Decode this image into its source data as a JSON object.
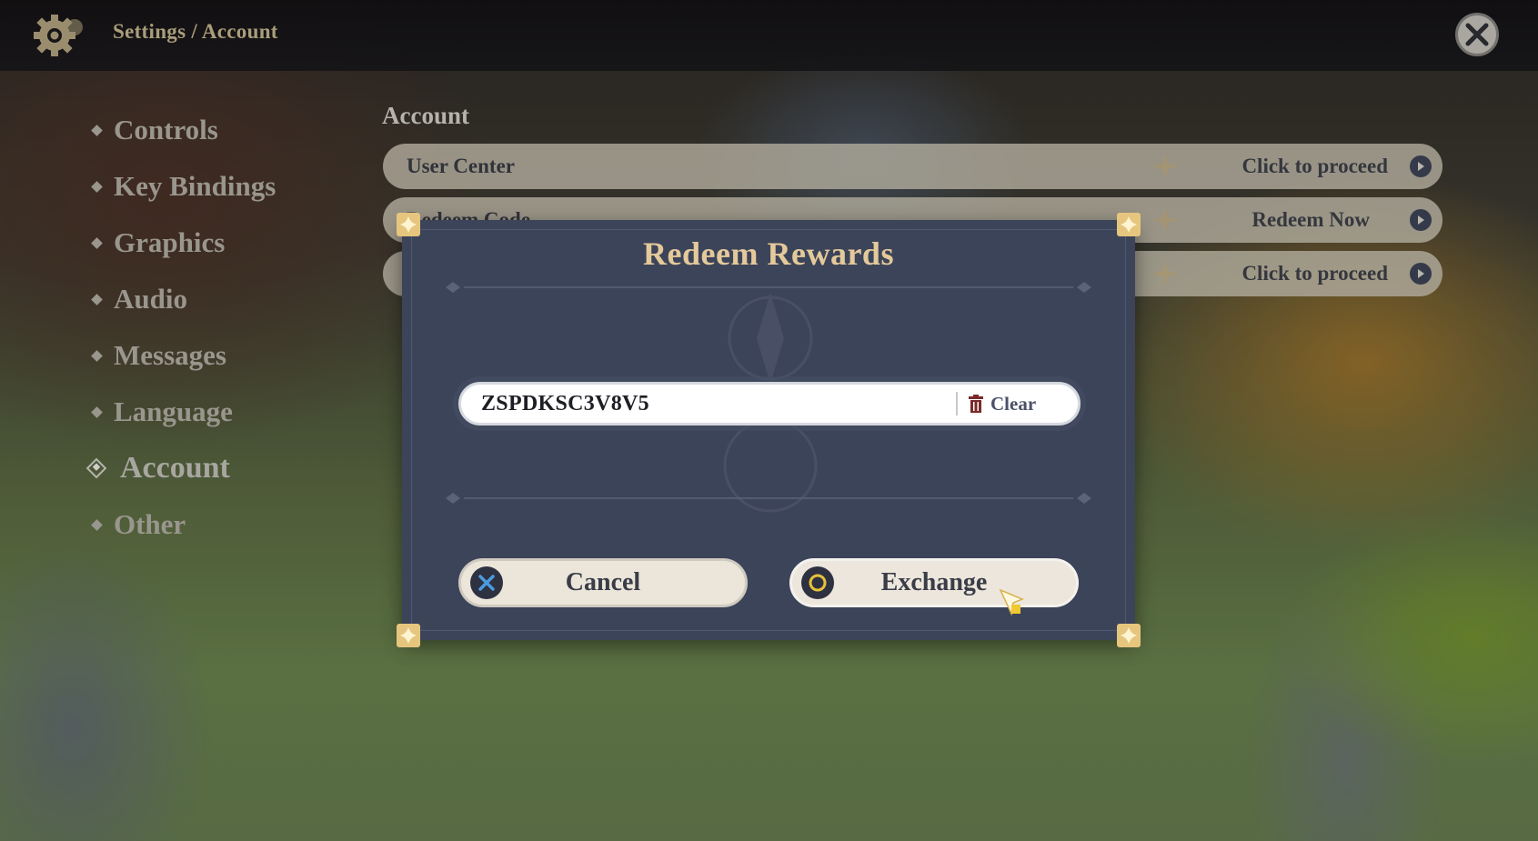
{
  "header": {
    "breadcrumb": "Settings / Account",
    "icons": {
      "settings": "gear-icon",
      "close": "close-icon"
    }
  },
  "sidebar": {
    "items": [
      {
        "label": "Controls",
        "active": false
      },
      {
        "label": "Key Bindings",
        "active": false
      },
      {
        "label": "Graphics",
        "active": false
      },
      {
        "label": "Audio",
        "active": false
      },
      {
        "label": "Messages",
        "active": false
      },
      {
        "label": "Language",
        "active": false
      },
      {
        "label": "Account",
        "active": true
      },
      {
        "label": "Other",
        "active": false
      }
    ]
  },
  "main": {
    "section_title": "Account",
    "rows": [
      {
        "label": "User Center",
        "action": "Click to proceed"
      },
      {
        "label": "Redeem Code",
        "action": "Redeem Now"
      },
      {
        "label": "",
        "action": "Click to proceed"
      }
    ]
  },
  "dialog": {
    "title": "Redeem Rewards",
    "code_value": "ZSPDKSC3V8V5",
    "clear_label": "Clear",
    "cancel_label": "Cancel",
    "exchange_label": "Exchange",
    "icons": {
      "cancel": "cross-button-icon",
      "exchange": "circle-button-icon",
      "clear": "trash-icon"
    }
  },
  "colors": {
    "dialog_bg": "#3c4459",
    "title_gold": "#e4c99a",
    "cancel_icon": "#4a9be0",
    "exchange_icon": "#e7c23a",
    "trash": "#7a2a2a"
  }
}
